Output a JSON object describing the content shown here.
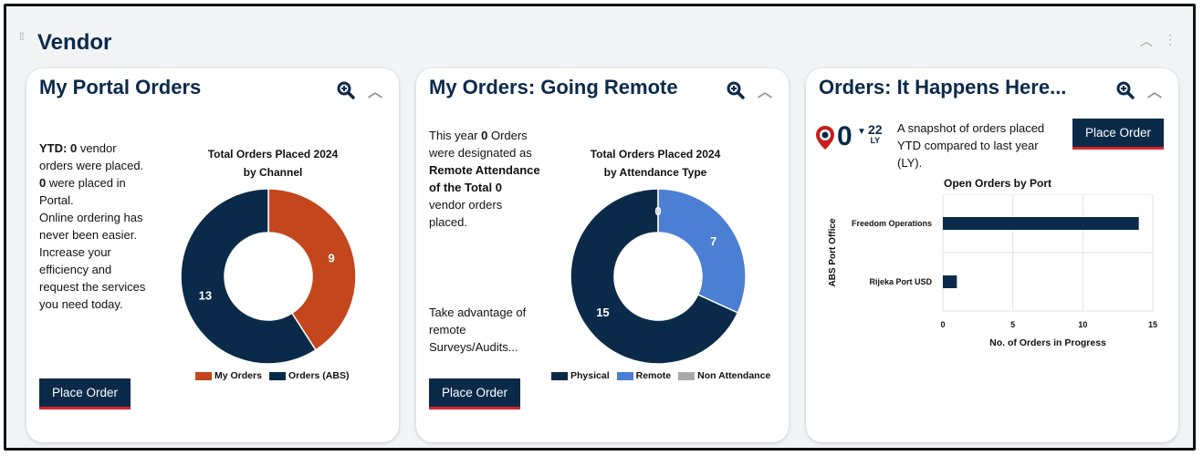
{
  "section": {
    "title": "Vendor"
  },
  "colors": {
    "navy": "#0b2a4a",
    "orange": "#c4461d",
    "blue": "#4a7fd4",
    "gray": "#a9a9a9",
    "accent_red": "#d7262d"
  },
  "cards": [
    {
      "title": "My Portal Orders",
      "ytd_label": "YTD:",
      "ytd_value": "0",
      "text1": "vendor orders were placed.",
      "portal_value": "0",
      "text2": "were placed in Portal.",
      "text3": "Online ordering has never been easier. Increase your efficiency and request the services you need today.",
      "button": "Place Order",
      "chart_title": "Total Orders Placed 2024",
      "chart_subtitle": "by Channel"
    },
    {
      "title": "My Orders: Going Remote",
      "t1": "This year",
      "v1": "0",
      "t2": "Orders were designated as",
      "bold1": "Remote Attendance of the Total",
      "v2": "0",
      "t3": "vendor orders placed.",
      "t4": "Take advantage of remote Surveys/Audits...",
      "button": "Place Order",
      "chart_title": "Total Orders Placed 2024",
      "chart_subtitle": "by Attendance Type"
    },
    {
      "title": "Orders: It Happens Here...",
      "current": "0",
      "last_year": "22",
      "ly_label": "LY",
      "snapshot": "A snapshot of orders placed YTD compared to last year (LY).",
      "button": "Place Order",
      "chart_title": "Open Orders by Port"
    }
  ],
  "chart_data": [
    {
      "type": "pie",
      "title": "Total Orders Placed 2024",
      "subtitle": "by Channel",
      "labels": [
        "My Orders",
        "Orders (ABS)"
      ],
      "values": [
        9,
        13
      ],
      "colors": [
        "#c4461d",
        "#0b2a4a"
      ]
    },
    {
      "type": "pie",
      "title": "Total Orders Placed 2024",
      "subtitle": "by Attendance Type",
      "labels": [
        "Physical",
        "Remote",
        "Non Attendance"
      ],
      "values": [
        15,
        7,
        0
      ],
      "colors": [
        "#0b2a4a",
        "#4a7fd4",
        "#a9a9a9"
      ]
    },
    {
      "type": "bar",
      "orientation": "horizontal",
      "title": "Open Orders by Port",
      "categories": [
        "Freedom Operations",
        "Rijeka Port USD"
      ],
      "values": [
        14,
        1
      ],
      "xlabel": "No. of Orders in Progress",
      "ylabel": "ABS Port Office",
      "xlim": [
        0,
        15
      ],
      "xticks": [
        0,
        5,
        10,
        15
      ],
      "color": "#0b2a4a"
    }
  ]
}
